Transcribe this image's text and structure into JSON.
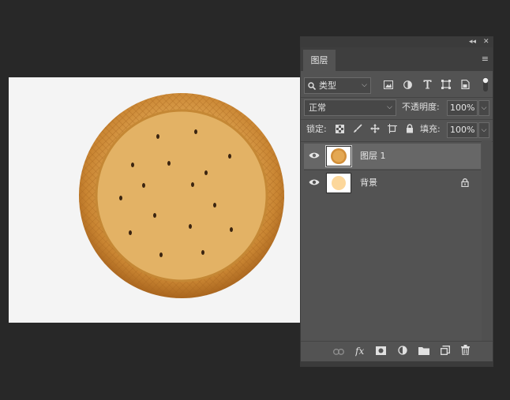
{
  "panel": {
    "collapse_label": "◂◂",
    "close_label": "✕",
    "tab_label": "图层",
    "menu_label": "≡"
  },
  "filter": {
    "kind_label": "类型"
  },
  "blend": {
    "mode": "正常",
    "opacity_label": "不透明度:",
    "opacity_value": "100%"
  },
  "lock": {
    "label": "锁定:",
    "fill_label": "填充:",
    "fill_value": "100%"
  },
  "layers": [
    {
      "name": "图层 1",
      "selected": true,
      "locked": false
    },
    {
      "name": "背景",
      "selected": false,
      "locked": true
    }
  ],
  "colors": {
    "workspace": "#282828",
    "panel": "#535353",
    "selected_layer": "#676767",
    "biscuit": "#d9a04a",
    "background_layer_swatch": "#fcd79b"
  },
  "icons": [
    "pixel-filter-icon",
    "adjustment-filter-icon",
    "type-filter-icon",
    "shape-filter-icon",
    "smart-object-filter-icon",
    "filter-toggle-icon",
    "lock-transparent-icon",
    "lock-paint-icon",
    "lock-position-icon",
    "lock-artboard-icon",
    "lock-all-icon",
    "link-layers-icon",
    "fx-icon",
    "add-mask-icon",
    "adjustment-layer-icon",
    "new-group-icon",
    "new-layer-icon",
    "delete-layer-icon"
  ]
}
